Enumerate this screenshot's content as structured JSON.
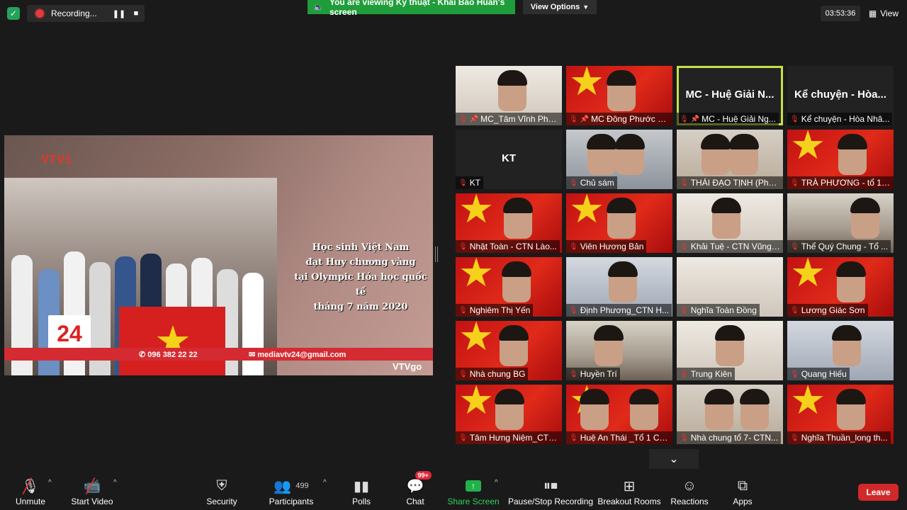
{
  "top": {
    "recording_label": "Recording...",
    "viewing_text": "You are viewing Kỹ thuật - Khải Bảo Huấn's screen",
    "view_options_label": "View Options",
    "timer": "03:53:36",
    "view_label": "View"
  },
  "share": {
    "channel_logo": "VTV1",
    "overlay_lines": [
      "Học sinh Việt Nam",
      "đạt Huy chương vàng",
      "tại Olympic Hóa học quốc tế",
      "tháng 7 năm 2020"
    ],
    "logo_24": "24",
    "phone": "096 382 22 22",
    "email": "mediavtv24@gmail.com",
    "vtvgo": "VTVgo"
  },
  "grid": [
    {
      "name": "MC_Tâm Vĩnh Pho...",
      "big": "",
      "pinned": true
    },
    {
      "name": "MC Đông Phước Nghĩa",
      "big": "",
      "pinned": true
    },
    {
      "name": "MC - Huệ Giải Ng...",
      "big": "MC - Huệ Giải N...",
      "pinned": true
    },
    {
      "name": "Kể chuyện - Hòa Nhâ...",
      "big": "Kể chuyện - Hòa...",
      "pinned": false
    },
    {
      "name": "KT",
      "big": "KT",
      "pinned": false
    },
    {
      "name": "Chủ sám",
      "big": "",
      "pinned": false
    },
    {
      "name": "THÁI ĐẠO TỊNH (Phật...",
      "big": "",
      "pinned": false
    },
    {
      "name": "TRÀ PHƯƠNG - tổ 1 ...",
      "big": "",
      "pinned": false
    },
    {
      "name": "Nhật Toàn - CTN Lào...",
      "big": "",
      "pinned": false
    },
    {
      "name": "Viên Hương Bản",
      "big": "",
      "pinned": false
    },
    {
      "name": "Khải Tuệ - CTN Vũng ...",
      "big": "",
      "pinned": false
    },
    {
      "name": "Thể Quý Chung - Tổ ...",
      "big": "",
      "pinned": false
    },
    {
      "name": "Nghiêm Thị Yến",
      "big": "",
      "pinned": false
    },
    {
      "name": "Định Phương_CTN H...",
      "big": "",
      "pinned": false
    },
    {
      "name": "Nghĩa Toàn Đồng",
      "big": "",
      "pinned": false
    },
    {
      "name": "Lương Giác Sơn",
      "big": "",
      "pinned": false
    },
    {
      "name": "Nhà chung BG",
      "big": "",
      "pinned": false
    },
    {
      "name": "Huyền Trí",
      "big": "",
      "pinned": false
    },
    {
      "name": "Trung Kiên",
      "big": "",
      "pinned": false
    },
    {
      "name": "Quang Hiếu",
      "big": "",
      "pinned": false
    },
    {
      "name": "Tâm Hưng Niệm_CTN...",
      "big": "",
      "pinned": false
    },
    {
      "name": "Huệ An Thái _Tổ 1 CT...",
      "big": "",
      "pinned": false
    },
    {
      "name": "Nhà chung tổ 7- CTN...",
      "big": "",
      "pinned": false
    },
    {
      "name": "Nghĩa Thuần_long th...",
      "big": "",
      "pinned": false
    }
  ],
  "toolbar": {
    "unmute": "Unmute",
    "start_video": "Start Video",
    "security": "Security",
    "participants": "Participants",
    "participants_count": "499",
    "polls": "Polls",
    "chat": "Chat",
    "chat_badge": "99+",
    "share_screen": "Share Screen",
    "pause_recording": "Pause/Stop Recording",
    "breakout_rooms": "Breakout Rooms",
    "reactions": "Reactions",
    "apps": "Apps",
    "leave": "Leave"
  },
  "colors": {
    "accent_green": "#1f9d3a",
    "leave_red": "#d1282a",
    "active_speaker": "#c6e04a"
  }
}
